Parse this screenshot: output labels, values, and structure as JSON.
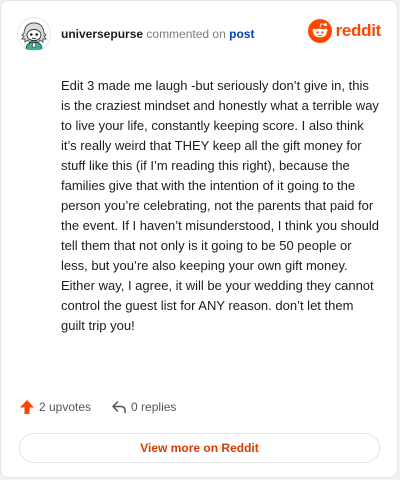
{
  "header": {
    "username": "universepurse",
    "action": "commented on",
    "post_link": "post",
    "logo_text": "reddit"
  },
  "comment": {
    "body": "Edit 3 made me laugh -but seriously don’t give in, this is the craziest mindset and honestly what a terrible way to live your life, constantly keeping score. I also think it’s really weird that THEY keep all the gift money for stuff like this (if I’m reading this right), because the families give that with the intention of it going to the person you’re celebrating, not the parents that paid for the event. If I haven’t misunderstood, I think you should tell them that not only is it going to be 50 people or less, but you’re also keeping your own gift money. Either way, I agree, it will be your wedding they cannot control the guest list for ANY reason. don’t let them guilt trip you!"
  },
  "footer": {
    "upvotes": "2 upvotes",
    "replies": "0 replies",
    "view_more": "View more on Reddit"
  },
  "colors": {
    "brand": "#ff4500",
    "link": "#0045ac",
    "view_more": "#d93a00"
  },
  "icons": {
    "avatar": "snoo-avatar",
    "logo": "reddit-snoo-icon",
    "upvote": "upvote-arrow-icon",
    "reply": "reply-arrow-icon"
  }
}
